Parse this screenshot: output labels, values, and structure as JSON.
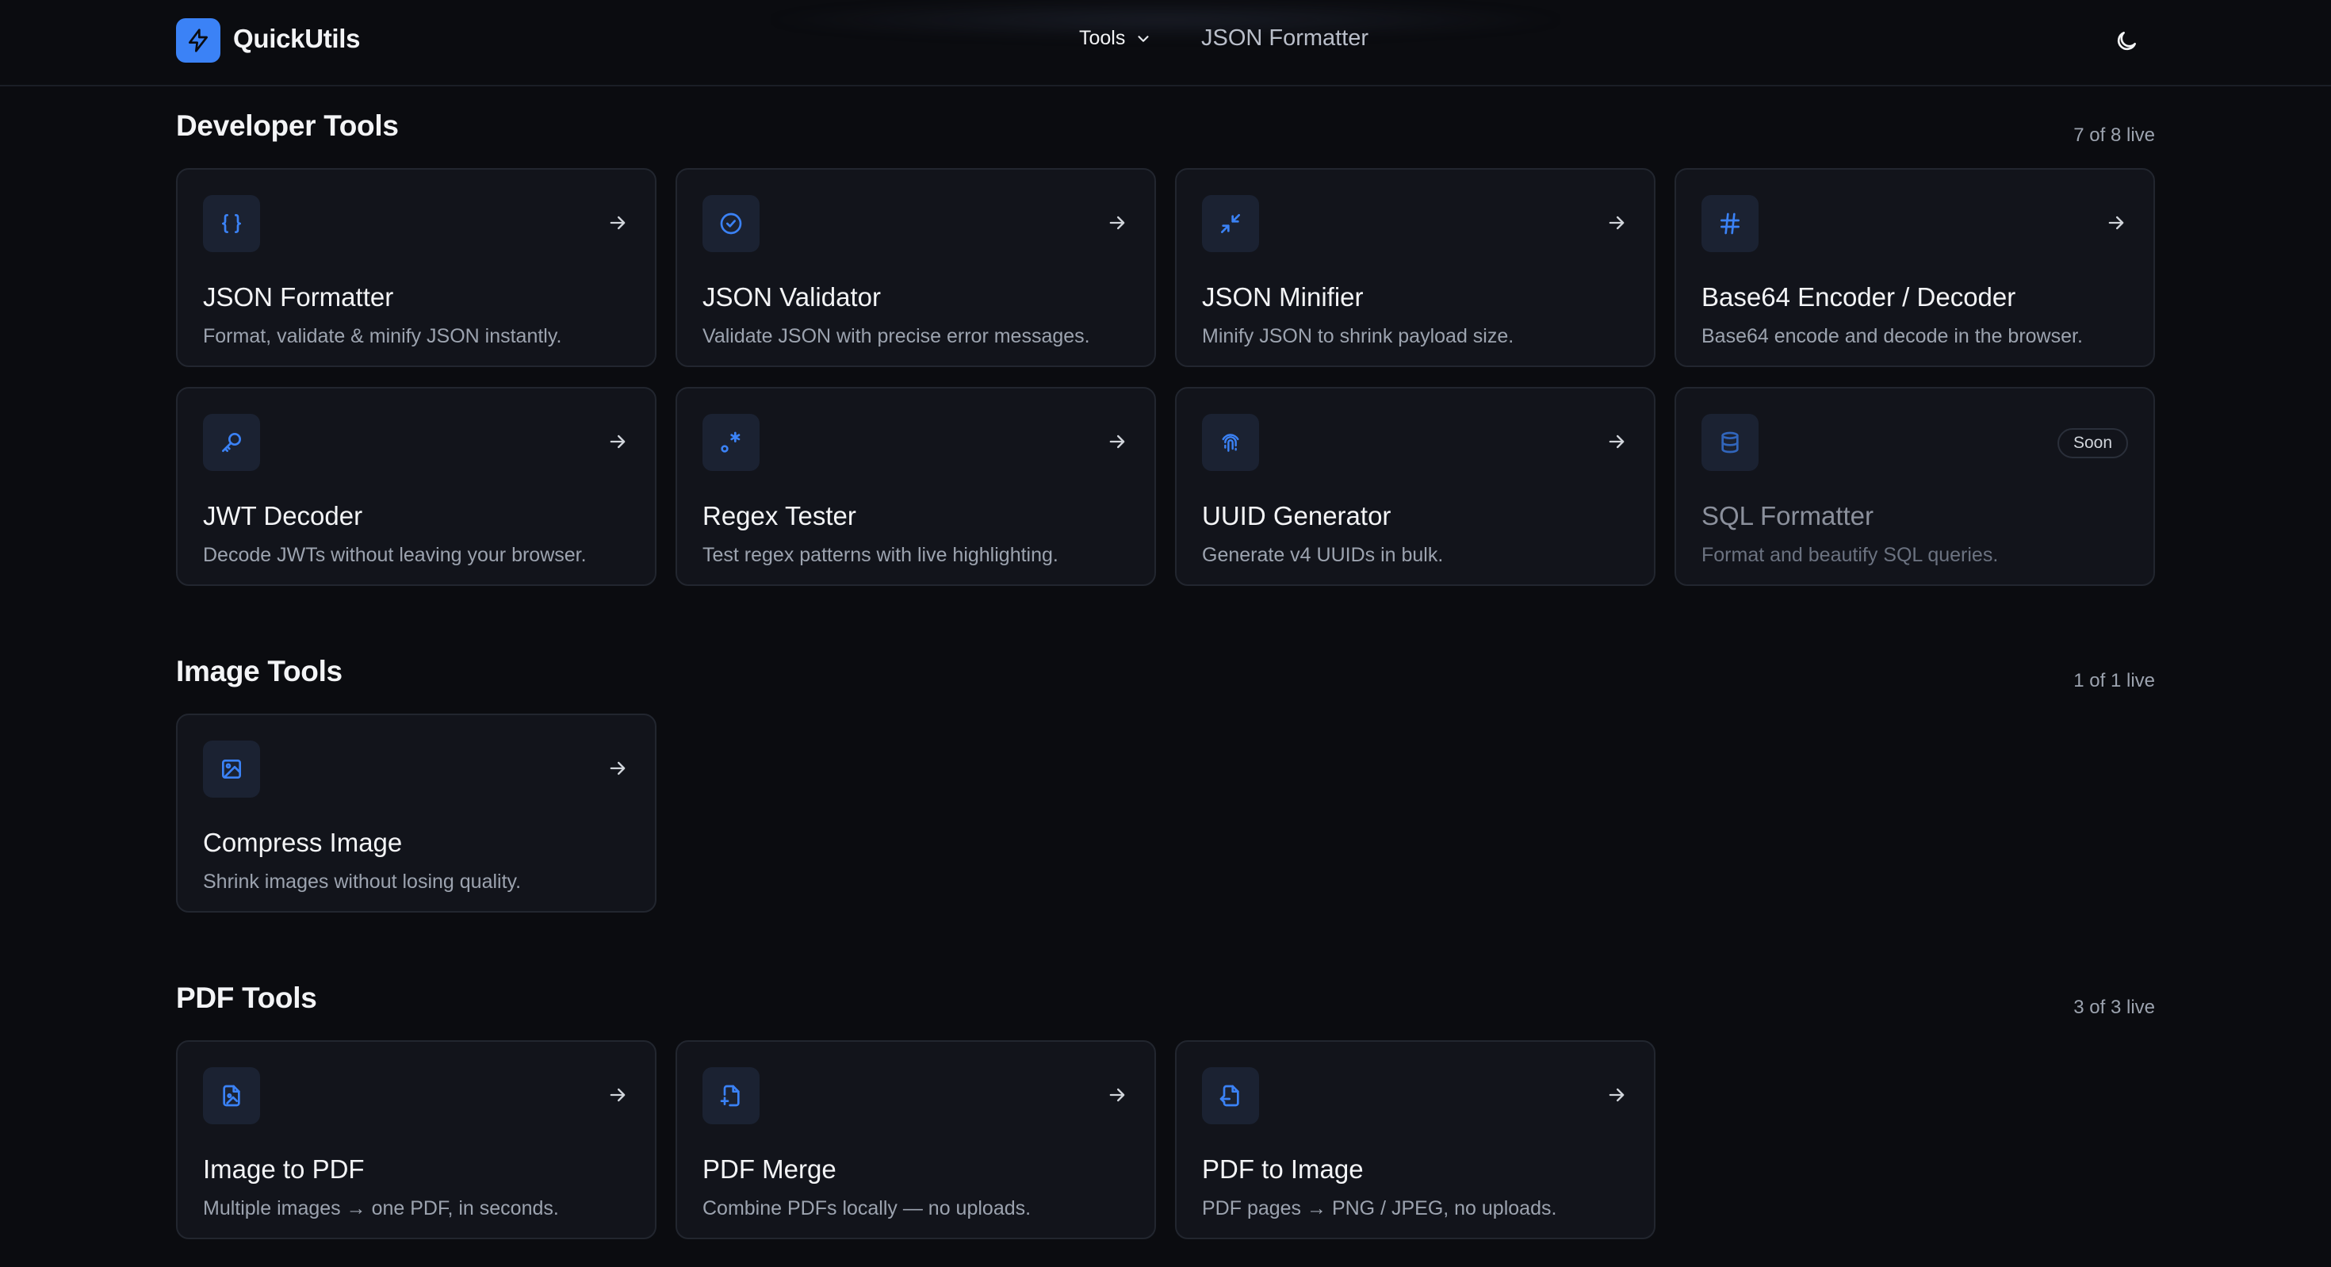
{
  "header": {
    "brand": "QuickUtils",
    "nav_tools_label": "Tools",
    "nav_link": "JSON Formatter"
  },
  "colors": {
    "accent": "#3b82f6",
    "background": "#0b0c10",
    "card": "#12141b"
  },
  "sections": [
    {
      "title": "Developer Tools",
      "count": "7 of 8 live",
      "cards": [
        {
          "title": "JSON Formatter",
          "desc": "Format, validate & minify JSON instantly.",
          "icon": "braces-icon"
        },
        {
          "title": "JSON Validator",
          "desc": "Validate JSON with precise error messages.",
          "icon": "check-circle-icon"
        },
        {
          "title": "JSON Minifier",
          "desc": "Minify JSON to shrink payload size.",
          "icon": "minimize-icon"
        },
        {
          "title": "Base64 Encoder / Decoder",
          "desc": "Base64 encode and decode in the browser.",
          "icon": "hash-icon"
        },
        {
          "title": "JWT Decoder",
          "desc": "Decode JWTs without leaving your browser.",
          "icon": "key-icon"
        },
        {
          "title": "Regex Tester",
          "desc": "Test regex patterns with live highlighting.",
          "icon": "regex-icon"
        },
        {
          "title": "UUID Generator",
          "desc": "Generate v4 UUIDs in bulk.",
          "icon": "fingerprint-icon"
        },
        {
          "title": "SQL Formatter",
          "desc": "Format and beautify SQL queries.",
          "icon": "database-icon",
          "badge": "Soon"
        }
      ]
    },
    {
      "title": "Image Tools",
      "count": "1 of 1 live",
      "cards": [
        {
          "title": "Compress Image",
          "desc": "Shrink images without losing quality.",
          "icon": "image-icon"
        }
      ]
    },
    {
      "title": "PDF Tools",
      "count": "3 of 3 live",
      "cards": [
        {
          "title": "Image to PDF",
          "desc": "Multiple images → one PDF, in seconds.",
          "icon": "file-image-icon"
        },
        {
          "title": "PDF Merge",
          "desc": "Combine PDFs locally — no uploads.",
          "icon": "file-plus-icon"
        },
        {
          "title": "PDF to Image",
          "desc": "PDF pages → PNG / JPEG, no uploads.",
          "icon": "file-export-icon"
        }
      ]
    }
  ]
}
